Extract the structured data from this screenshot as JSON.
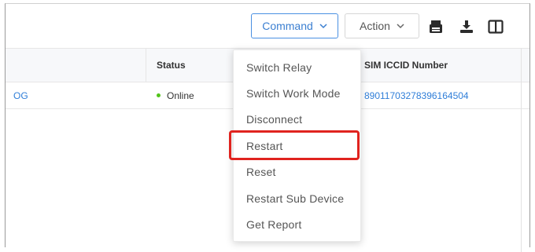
{
  "toolbar": {
    "command_label": "Command",
    "action_label": "Action",
    "icons": [
      "print-icon",
      "download-icon",
      "columns-icon"
    ]
  },
  "table": {
    "columns": {
      "status": "Status",
      "sim_iccid": "SIM ICCID Number"
    },
    "rows": [
      {
        "name_fragment": "OG",
        "status": "Online",
        "sim_iccid": "89011703278396164504"
      }
    ]
  },
  "command_menu": {
    "items": [
      "Switch Relay",
      "Switch Work Mode",
      "Disconnect",
      "Restart",
      "Reset",
      "Restart Sub Device",
      "Get Report"
    ],
    "highlighted_item": "Restart"
  },
  "colors": {
    "accent": "#3b7fd1",
    "link": "#2f7ed8",
    "online": "#52c41a",
    "highlight": "#e0231f"
  }
}
